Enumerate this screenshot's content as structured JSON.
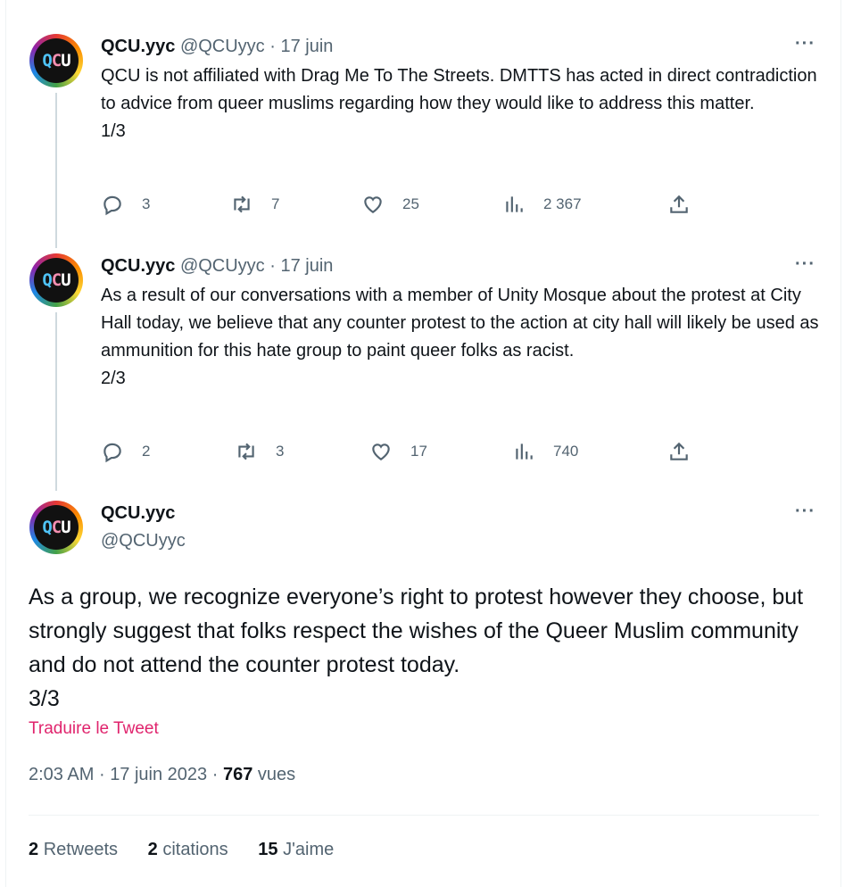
{
  "tweets": [
    {
      "name": "QCU.yyc",
      "handle": "@QCUyyc",
      "sep": "·",
      "date": "17 juin",
      "text": "QCU is not affiliated with Drag Me To The Streets. DMTTS has acted in direct contradiction to advice from queer muslims regarding how they would like to address this matter.",
      "counter": "1/3",
      "replies": "3",
      "retweets": "7",
      "likes": "25",
      "views": "2 367"
    },
    {
      "name": "QCU.yyc",
      "handle": "@QCUyyc",
      "sep": "·",
      "date": "17 juin",
      "text": "As a result of our conversations with a member of Unity Mosque about the protest at City Hall today, we believe that any counter protest to the action at city hall will likely be used as ammunition for this hate group to paint queer folks as racist.",
      "counter": "2/3",
      "replies": "2",
      "retweets": "3",
      "likes": "17",
      "views": "740"
    }
  ],
  "main": {
    "name": "QCU.yyc",
    "handle": "@QCUyyc",
    "text": "As a group, we recognize everyone’s right to protest however they choose, but strongly suggest that folks respect the wishes of the Queer Muslim community and do not attend the counter protest today.",
    "counter": "3/3",
    "translate": "Traduire le Tweet",
    "time": "2:03 AM",
    "sep": "·",
    "date": "17 juin 2023",
    "views_count": "767",
    "views_label": "vues",
    "retweets_count": "2",
    "retweets_label": "Retweets",
    "quotes_count": "2",
    "quotes_label": "citations",
    "likes_count": "15",
    "likes_label": "J'aime"
  },
  "more_icon": "···",
  "avatar": {
    "q": "Q",
    "c": "C",
    "u": "U"
  },
  "colors": {
    "accent": "#e0246d",
    "muted": "#536471",
    "text": "#0f1419"
  }
}
